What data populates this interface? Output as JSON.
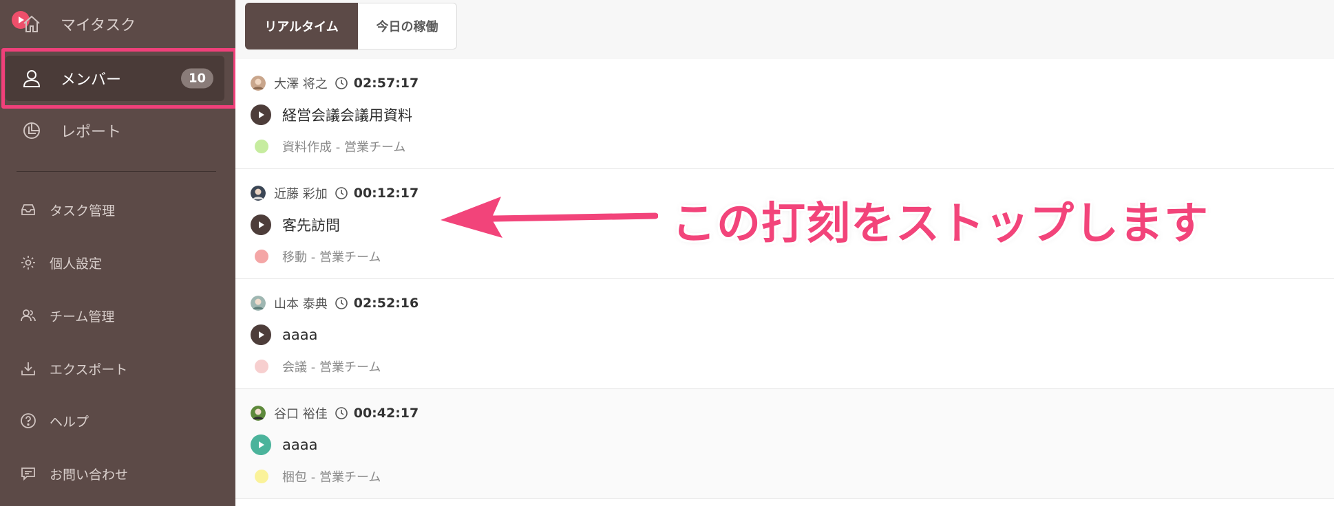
{
  "sidebar": {
    "top_items": [
      {
        "label": "マイタスク",
        "icon": "home-icon"
      },
      {
        "label": "メンバー",
        "icon": "person-icon",
        "badge": "10",
        "active": true
      },
      {
        "label": "レポート",
        "icon": "pie-chart-icon"
      }
    ],
    "items": [
      {
        "label": "タスク管理",
        "icon": "inbox-icon"
      },
      {
        "label": "個人設定",
        "icon": "gear-icon"
      },
      {
        "label": "チーム管理",
        "icon": "team-icon"
      },
      {
        "label": "エクスポート",
        "icon": "download-icon"
      },
      {
        "label": "ヘルプ",
        "icon": "help-icon"
      },
      {
        "label": "お問い合わせ",
        "icon": "chat-icon"
      }
    ]
  },
  "tabs": [
    {
      "label": "リアルタイム",
      "active": true
    },
    {
      "label": "今日の稼働",
      "active": false
    }
  ],
  "entries": [
    {
      "name": "大澤 将之",
      "time": "02:57:17",
      "task": "経営会議会議用資料",
      "category": "資料作成 - 営業チーム",
      "color": "#c6ec9f",
      "running_color": "dark"
    },
    {
      "name": "近藤 彩加",
      "time": "00:12:17",
      "task": "客先訪問",
      "category": "移動 - 営業チーム",
      "color": "#f4a6a6",
      "running_color": "dark"
    },
    {
      "name": "山本 泰典",
      "time": "02:52:16",
      "task": "aaaa",
      "category": "会議 - 営業チーム",
      "color": "#f7cfcf",
      "running_color": "dark"
    },
    {
      "name": "谷口 裕佳",
      "time": "00:42:17",
      "task": "aaaa",
      "category": "梱包 - 営業チーム",
      "color": "#faf29a",
      "running_color": "green"
    }
  ],
  "annotation": {
    "text": "この打刻をストップします",
    "color": "#f2447a"
  },
  "colors": {
    "sidebar_bg": "#5c4a47",
    "accent": "#f0407a",
    "active_tab": "#5c4a47"
  }
}
